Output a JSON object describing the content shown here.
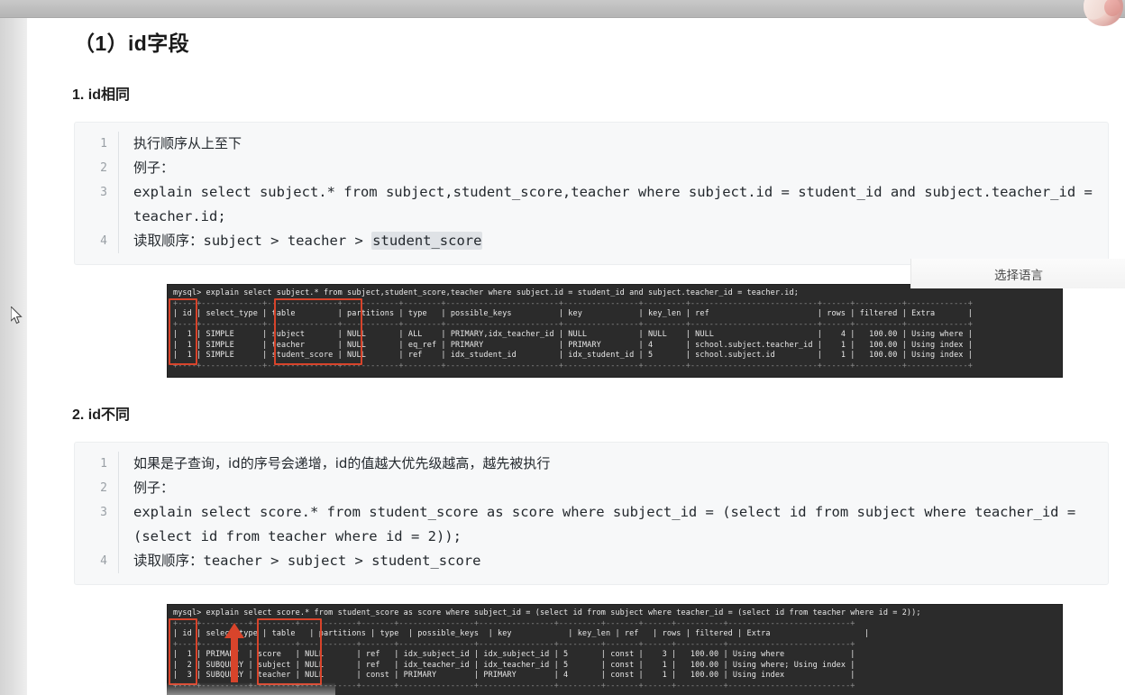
{
  "window": {
    "avatar_label": "user-avatar",
    "language_selector": "选择语言"
  },
  "article": {
    "title": "（1）id字段",
    "sections": [
      {
        "heading": "1. id相同",
        "code": {
          "lines": [
            {
              "no": "1",
              "text": "执行顺序从上至下",
              "cjk": true
            },
            {
              "no": "2",
              "text": "例子：",
              "cjk": true
            },
            {
              "no": "3",
              "text": "explain select subject.* from subject,student_score,teacher where subject.id = student_id and subject.teacher_id = teacher.id;",
              "cjk": false
            },
            {
              "no": "4",
              "prefix": "读取顺序：",
              "text": "subject > teacher > ",
              "highlight": "student_score",
              "cjk": false
            }
          ]
        },
        "terminal": {
          "command": "mysql> explain select subject.* from subject,student_score,teacher where subject.id = student_id and subject.teacher_id = teacher.id;",
          "columns": [
            "id",
            "select_type",
            "table",
            "partitions",
            "type",
            "possible_keys",
            "key",
            "key_len",
            "ref",
            "rows",
            "filtered",
            "Extra"
          ],
          "rows": [
            [
              "1",
              "SIMPLE",
              "subject",
              "NULL",
              "ALL",
              "PRIMARY,idx_teacher_id",
              "NULL",
              "NULL",
              "NULL",
              "4",
              "100.00",
              "Using where"
            ],
            [
              "1",
              "SIMPLE",
              "teacher",
              "NULL",
              "eq_ref",
              "PRIMARY",
              "PRIMARY",
              "4",
              "school.subject.teacher_id",
              "1",
              "100.00",
              "Using index"
            ],
            [
              "1",
              "SIMPLE",
              "student_score",
              "NULL",
              "ref",
              "idx_student_id",
              "idx_student_id",
              "5",
              "school.subject.id",
              "1",
              "100.00",
              "Using index"
            ]
          ],
          "annotations": [
            "id-column-box",
            "table-column-box"
          ]
        }
      },
      {
        "heading": "2. id不同",
        "code": {
          "lines": [
            {
              "no": "1",
              "text": "如果是子查询，id的序号会递增，id的值越大优先级越高，越先被执行",
              "cjk": true
            },
            {
              "no": "2",
              "text": "例子：",
              "cjk": true
            },
            {
              "no": "3",
              "text": "explain select score.* from student_score as score where subject_id = (select id from subject where teacher_id = (select id from teacher where id = 2));",
              "cjk": false
            },
            {
              "no": "4",
              "prefix": "读取顺序：",
              "text": "teacher > subject > student_score",
              "cjk": false
            }
          ]
        },
        "terminal": {
          "command": "mysql> explain select score.* from student_score as score where subject_id = (select id from subject where teacher_id = (select id from teacher where id = 2));",
          "columns": [
            "id",
            "select_type",
            "table",
            "partitions",
            "type",
            "possible_keys",
            "key",
            "key_len",
            "ref",
            "rows",
            "filtered",
            "Extra"
          ],
          "rows": [
            [
              "1",
              "PRIMARY",
              "score",
              "NULL",
              "ref",
              "idx_subject_id",
              "idx_subject_id",
              "5",
              "const",
              "3",
              "100.00",
              "Using where"
            ],
            [
              "2",
              "SUBQUERY",
              "subject",
              "NULL",
              "ref",
              "idx_teacher_id",
              "idx_teacher_id",
              "5",
              "const",
              "1",
              "100.00",
              "Using where; Using index"
            ],
            [
              "3",
              "SUBQUERY",
              "teacher",
              "NULL",
              "const",
              "PRIMARY",
              "PRIMARY",
              "4",
              "const",
              "1",
              "100.00",
              "Using index"
            ]
          ],
          "annotations": [
            "id-column-box",
            "table-column-box",
            "execution-order-arrow"
          ]
        }
      }
    ]
  },
  "colors": {
    "annotation_red": "#d8442b",
    "terminal_bg": "#2b2b2b",
    "code_bg": "#f7f8f9",
    "highlight": "#dfe2e6"
  }
}
